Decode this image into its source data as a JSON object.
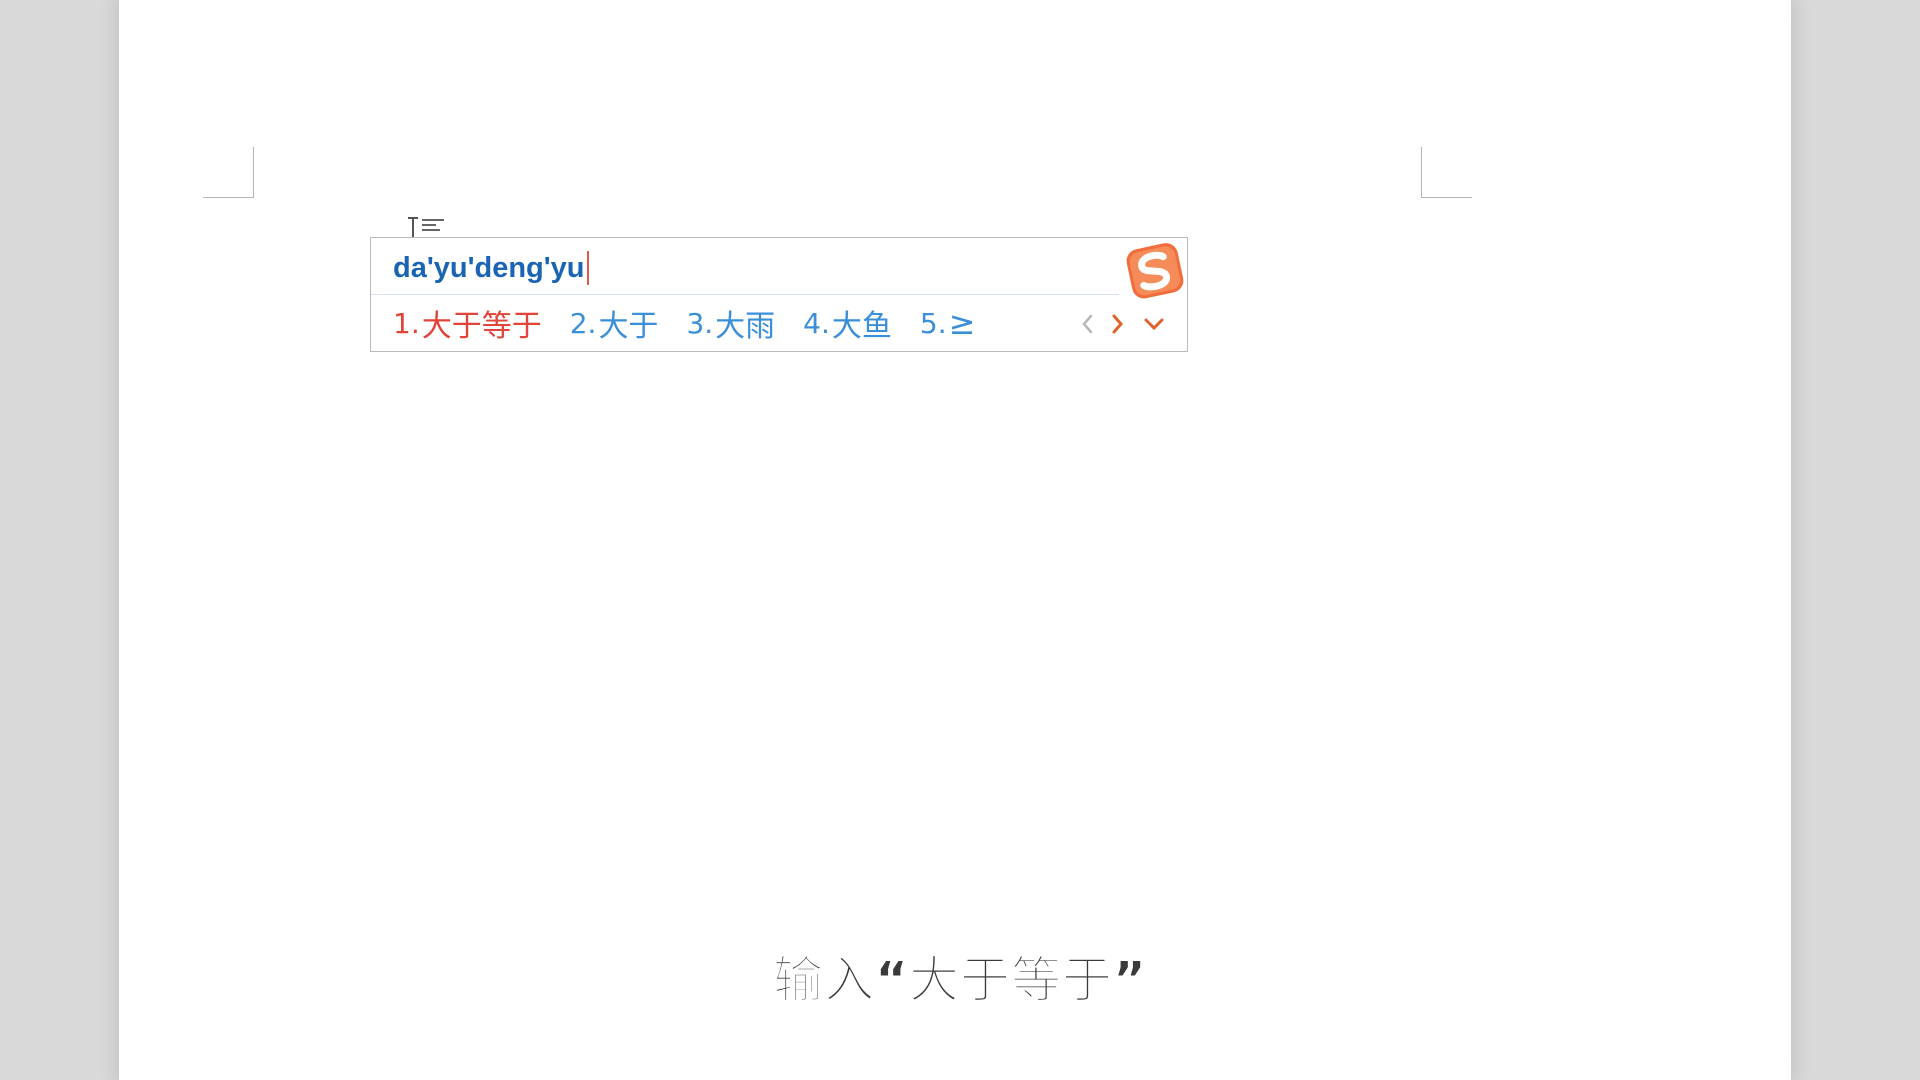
{
  "document": {
    "background_color": "#d9d9d9",
    "page_color": "#ffffff"
  },
  "ime": {
    "input_text": "da'yu'deng'yu",
    "logo_icon": "sogou-s-icon",
    "colors": {
      "input": "#1b64b4",
      "selected": "#e0443a",
      "candidate": "#3a8fd8",
      "logo": "#f26d3d"
    },
    "candidates": [
      {
        "number": "1.",
        "text": "大于等于",
        "selected": true
      },
      {
        "number": "2.",
        "text": "大于",
        "selected": false
      },
      {
        "number": "3.",
        "text": "大雨",
        "selected": false
      },
      {
        "number": "4.",
        "text": "大鱼",
        "selected": false
      },
      {
        "number": "5.",
        "text": "≥",
        "selected": false
      }
    ],
    "nav": {
      "prev_icon": "chevron-left-icon",
      "next_icon": "chevron-right-icon",
      "more_icon": "chevron-down-icon"
    }
  },
  "subtitle": "输入“大于等于”"
}
